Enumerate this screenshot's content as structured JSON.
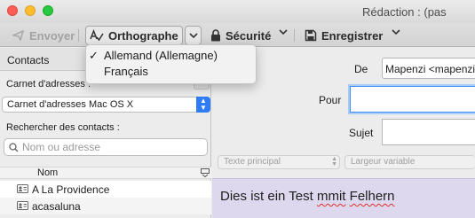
{
  "window": {
    "title": "Rédaction : (pas"
  },
  "toolbar": {
    "send_label": "Envoyer",
    "spelling_label": "Orthographe",
    "security_label": "Sécurité",
    "save_label": "Enregistrer"
  },
  "spelling_menu": {
    "items": [
      {
        "label": "Allemand (Allemagne)",
        "checked": true,
        "check_glyph": "✓"
      },
      {
        "label": "Français",
        "checked": false
      }
    ]
  },
  "contacts_panel": {
    "title": "Contacts",
    "address_book_label": "Carnet d'adresses :",
    "address_book_value": "Carnet d'adresses Mac OS X",
    "search_label": "Rechercher des contacts :",
    "search_placeholder": "Nom ou adresse",
    "column_name": "Nom",
    "contacts": [
      {
        "name": "A La Providence"
      },
      {
        "name": "acasaluna"
      }
    ]
  },
  "compose": {
    "from_label": "De",
    "from_value": "Mapenzi <mapenzi",
    "to_label": "Pour",
    "to_value": "",
    "subject_label": "Sujet",
    "subject_value": "",
    "paragraph_format": "Texte principal",
    "font_width": "Largeur variable",
    "body_words": [
      "Dies",
      "ist",
      "ein",
      "Test",
      "mmit",
      "Felhern"
    ]
  },
  "colors": {
    "accent": "#2e7cf6",
    "focus_ring": "#a9cbf8",
    "editor_bg": "#ddd8ee",
    "spell_error": "#e0302a"
  },
  "icons": {
    "send": "send-icon",
    "spelling": "spellcheck-icon",
    "security": "lock-icon",
    "save": "save-icon",
    "search": "search-icon",
    "contact": "contact-card-icon",
    "column_picker": "column-picker-icon"
  }
}
